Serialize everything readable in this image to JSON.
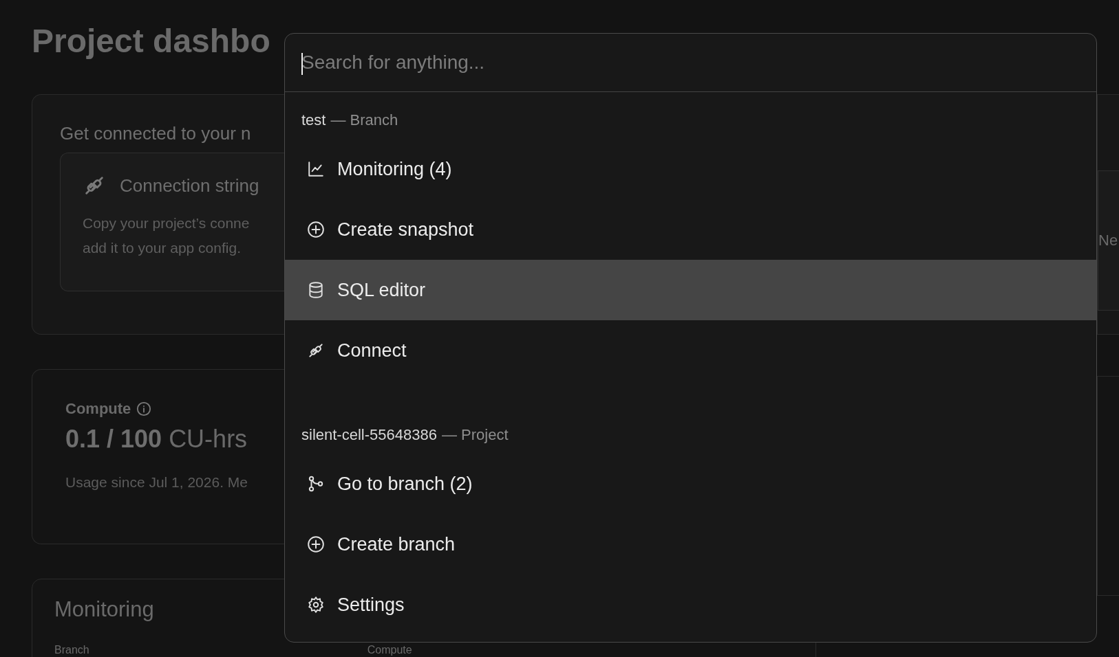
{
  "page": {
    "title": "Project dashbo",
    "connect_card": {
      "heading": "Get connected to your n",
      "option": {
        "title": "Connection string",
        "description": [
          "Copy your project’s conne",
          "add it to your app config."
        ]
      }
    },
    "compute_card": {
      "label": "Compute",
      "usage_value": "0.1 / 100",
      "usage_unit": "CU-hrs",
      "note": "Usage since Jul 1, 2026. Me"
    },
    "monitoring_card": {
      "title": "Monitoring",
      "columns": [
        "Branch",
        "Compute"
      ]
    },
    "side_card": {
      "text": "Ne"
    }
  },
  "command_palette": {
    "search": {
      "placeholder": "Search for anything..."
    },
    "groups": [
      {
        "name": "test",
        "type": "— Branch",
        "items": [
          {
            "label": "Monitoring (4)",
            "selected": false
          },
          {
            "label": "Create snapshot",
            "selected": false
          },
          {
            "label": "SQL editor",
            "selected": true
          },
          {
            "label": "Connect",
            "selected": false
          }
        ]
      },
      {
        "name": "silent-cell-55648386",
        "type": "— Project",
        "items": [
          {
            "label": "Go to branch (2)",
            "selected": false
          },
          {
            "label": "Create branch",
            "selected": false
          },
          {
            "label": "Settings",
            "selected": false
          }
        ]
      }
    ]
  }
}
